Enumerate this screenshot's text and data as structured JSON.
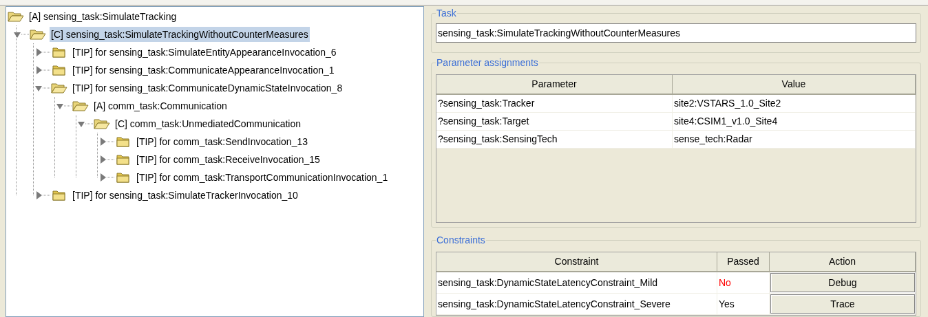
{
  "tree": [
    {
      "label": "[A] sensing_task:SimulateTracking",
      "expanded": true,
      "selected": false,
      "children": [
        {
          "label": "[C] sensing_task:SimulateTrackingWithoutCounterMeasures",
          "expanded": true,
          "selected": true,
          "children": [
            {
              "label": "[TIP] for sensing_task:SimulateEntityAppearanceInvocation_6",
              "expanded": false,
              "selected": false
            },
            {
              "label": "[TIP] for sensing_task:CommunicateAppearanceInvocation_1",
              "expanded": false,
              "selected": false
            },
            {
              "label": "[TIP] for sensing_task:CommunicateDynamicStateInvocation_8",
              "expanded": true,
              "selected": false,
              "children": [
                {
                  "label": "[A] comm_task:Communication",
                  "expanded": true,
                  "selected": false,
                  "children": [
                    {
                      "label": "[C] comm_task:UnmediatedCommunication",
                      "expanded": true,
                      "selected": false,
                      "children": [
                        {
                          "label": "[TIP] for comm_task:SendInvocation_13",
                          "expanded": false,
                          "selected": false
                        },
                        {
                          "label": "[TIP] for comm_task:ReceiveInvocation_15",
                          "expanded": false,
                          "selected": false
                        },
                        {
                          "label": "[TIP] for comm_task:TransportCommunicationInvocation_1",
                          "expanded": false,
                          "selected": false
                        }
                      ]
                    }
                  ]
                }
              ]
            },
            {
              "label": "[TIP] for sensing_task:SimulateTrackerInvocation_10",
              "expanded": false,
              "selected": false
            }
          ]
        }
      ]
    }
  ],
  "task": {
    "legend": "Task",
    "value": "sensing_task:SimulateTrackingWithoutCounterMeasures"
  },
  "parameters": {
    "legend": "Parameter assignments",
    "columns": [
      "Parameter",
      "Value"
    ],
    "rows": [
      [
        "?sensing_task:Tracker",
        "site2:VSTARS_1.0_Site2"
      ],
      [
        "?sensing_task:Target",
        "site4:CSIM1_v1.0_Site4"
      ],
      [
        "?sensing_task:SensingTech",
        "sense_tech:Radar"
      ]
    ]
  },
  "constraints": {
    "legend": "Constraints",
    "columns": [
      "Constraint",
      "Passed",
      "Action"
    ],
    "rows": [
      {
        "constraint": "sensing_task:DynamicStateLatencyConstraint_Mild",
        "passed_text": "No",
        "passed": false,
        "action": "Debug"
      },
      {
        "constraint": "sensing_task:DynamicStateLatencyConstraint_Severe",
        "passed_text": "Yes",
        "passed": true,
        "action": "Trace"
      }
    ]
  }
}
